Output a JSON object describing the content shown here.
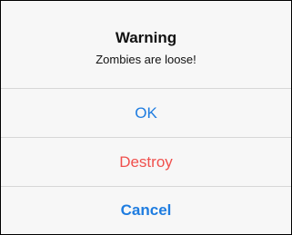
{
  "alert": {
    "title": "Warning",
    "message": "Zombies are loose!",
    "actions": [
      {
        "label": "OK",
        "style": "default",
        "color": "#1e7ce0"
      },
      {
        "label": "Destroy",
        "style": "destructive",
        "color": "#f0504d"
      },
      {
        "label": "Cancel",
        "style": "cancel",
        "color": "#1e7ce0"
      }
    ]
  }
}
